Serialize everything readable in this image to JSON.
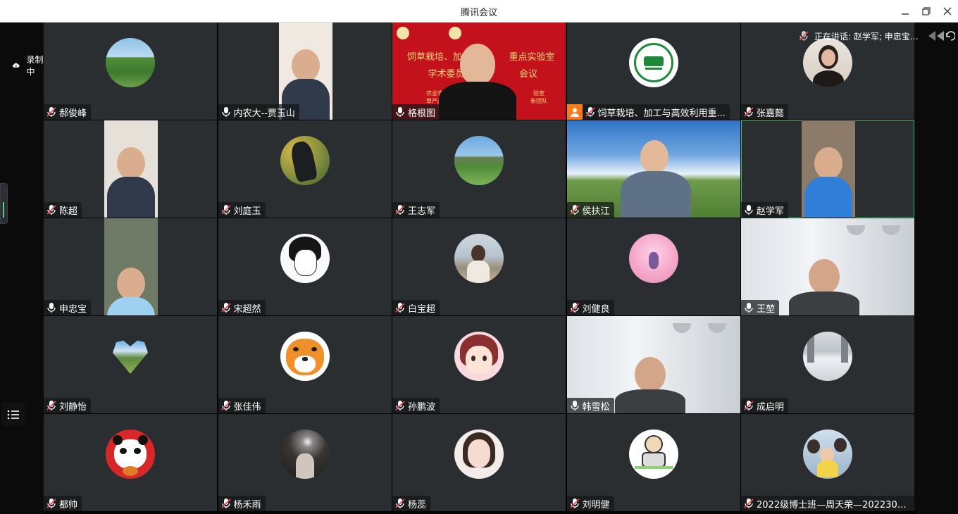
{
  "window": {
    "title": "腾讯会议"
  },
  "recording": {
    "label": "录制中"
  },
  "speaking": {
    "label": "正在讲话: 赵学军; 申忠宝;..."
  },
  "participants": [
    {
      "name": "郝俊峰",
      "mic": "muted",
      "type": "avatar",
      "avatar": "grassland-photo"
    },
    {
      "name": "内农大--贾玉山",
      "mic": "on",
      "type": "video"
    },
    {
      "name": "格根图",
      "mic": "on",
      "type": "video-banner",
      "banner": {
        "title1": "饲草栽培、加工与",
        "title1b": "重点实验室",
        "title2": "学术委员会",
        "title2b": "会议",
        "small1": "农业农村部",
        "small1b": "验室",
        "small2": "草产品加工",
        "small2b": "新团队"
      }
    },
    {
      "name": "饲草栽培、加工与高效利用重...",
      "mic": "muted",
      "type": "avatar",
      "avatar": "lab-logo",
      "badge": "cohost"
    },
    {
      "name": "张嘉懿",
      "mic": "muted",
      "type": "avatar",
      "avatar": "woman-photo"
    },
    {
      "name": "陈超",
      "mic": "muted",
      "type": "video"
    },
    {
      "name": "刘庭玉",
      "mic": "muted",
      "type": "avatar",
      "avatar": "horse-photo"
    },
    {
      "name": "王志军",
      "mic": "muted",
      "type": "avatar",
      "avatar": "field-photo"
    },
    {
      "name": "侯扶江",
      "mic": "muted",
      "type": "video",
      "scene": "sky"
    },
    {
      "name": "赵学军",
      "mic": "on",
      "type": "video",
      "active": true
    },
    {
      "name": "申忠宝",
      "mic": "on",
      "type": "video"
    },
    {
      "name": "宋超然",
      "mic": "muted",
      "type": "avatar",
      "avatar": "anime-sketch"
    },
    {
      "name": "白宝超",
      "mic": "muted",
      "type": "avatar",
      "avatar": "seaside-photo"
    },
    {
      "name": "刘健良",
      "mic": "muted",
      "type": "avatar",
      "avatar": "pink-illustration"
    },
    {
      "name": "王堃",
      "mic": "on",
      "type": "video",
      "scene": "office"
    },
    {
      "name": "刘静怡",
      "mic": "muted",
      "type": "avatar",
      "avatar": "heart-landscape"
    },
    {
      "name": "张佳伟",
      "mic": "muted",
      "type": "avatar",
      "avatar": "tiger"
    },
    {
      "name": "孙鹏波",
      "mic": "muted",
      "type": "avatar",
      "avatar": "cartoon-girl"
    },
    {
      "name": "韩雪松",
      "mic": "on",
      "type": "video",
      "scene": "office"
    },
    {
      "name": "成启明",
      "mic": "muted",
      "type": "avatar",
      "avatar": "snow-road"
    },
    {
      "name": "都帅",
      "mic": "muted",
      "type": "avatar",
      "avatar": "panda"
    },
    {
      "name": "杨禾雨",
      "mic": "muted",
      "type": "avatar",
      "avatar": "dark-photo"
    },
    {
      "name": "杨蕊",
      "mic": "muted",
      "type": "avatar",
      "avatar": "girl-photo"
    },
    {
      "name": "刘明健",
      "mic": "muted",
      "type": "avatar",
      "avatar": "astronaut"
    },
    {
      "name": "2022级博士班—周天荣—2022302...",
      "mic": "muted",
      "type": "avatar",
      "avatar": "family-photo"
    }
  ],
  "colors": {
    "tile": "#2b2e31",
    "active_border": "#2fbf71",
    "muted_red": "#e5484d",
    "banner_red": "#c4121c",
    "banner_text": "#f6d97a",
    "cohost_orange": "#ff7a1a"
  }
}
